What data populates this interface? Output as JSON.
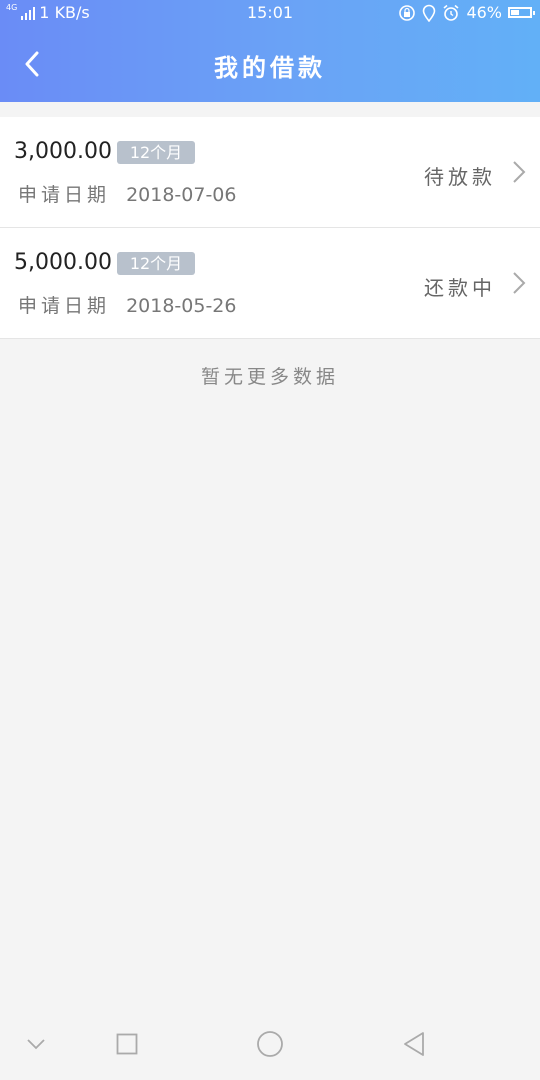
{
  "status_bar": {
    "network_type": "4G",
    "speed": "1 KB/s",
    "time": "15:01",
    "battery": "46%",
    "battery_level": 0.46,
    "icons": [
      "lock-rotate-icon",
      "location-icon",
      "alarm-icon",
      "battery-icon"
    ]
  },
  "header": {
    "title": "我的借款",
    "back_icon": "chevron-left-icon"
  },
  "loans": [
    {
      "amount": "3,000.00",
      "term": "12个月",
      "date_label": "申请日期",
      "date": "2018-07-06",
      "status": "待放款"
    },
    {
      "amount": "5,000.00",
      "term": "12个月",
      "date_label": "申请日期",
      "date": "2018-05-26",
      "status": "还款中"
    }
  ],
  "no_more_text": "暂无更多数据",
  "colors": {
    "header_gradient_start": "#6a8cf6",
    "header_gradient_end": "#62b0f7",
    "badge_bg": "#b8c1cc",
    "page_bg": "#f4f4f4"
  },
  "navbar": {
    "buttons": [
      "chevron-down-icon",
      "square-icon",
      "circle-icon",
      "triangle-back-icon"
    ]
  }
}
